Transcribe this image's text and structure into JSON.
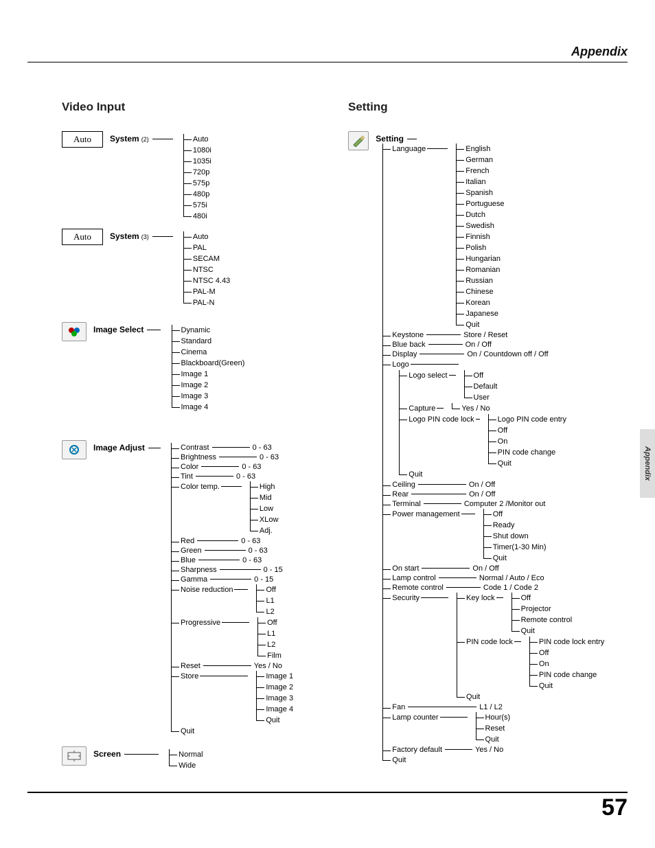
{
  "header": {
    "title": "Appendix"
  },
  "sideTab": "Appendix",
  "pageNumber": "57",
  "videoInput": {
    "title": "Video Input",
    "auto1": "Auto",
    "auto2": "Auto",
    "system2": {
      "label": "System",
      "note": "(2)",
      "items": [
        "Auto",
        "1080i",
        "1035i",
        "720p",
        "575p",
        "480p",
        "575i",
        "480i"
      ]
    },
    "system3": {
      "label": "System",
      "note": "(3)",
      "items": [
        "Auto",
        "PAL",
        "SECAM",
        "NTSC",
        "NTSC 4.43",
        "PAL-M",
        "PAL-N"
      ]
    },
    "imageSelect": {
      "label": "Image Select",
      "items": [
        "Dynamic",
        "Standard",
        "Cinema",
        "Blackboard(Green)",
        "Image 1",
        "Image 2",
        "Image 3",
        "Image 4"
      ]
    },
    "imageAdjust": {
      "label": "Image Adjust",
      "ranged": [
        {
          "k": "Contrast",
          "v": "0 - 63"
        },
        {
          "k": "Brightness",
          "v": "0 - 63"
        },
        {
          "k": "Color",
          "v": "0 - 63"
        },
        {
          "k": "Tint",
          "v": "0 - 63"
        }
      ],
      "colorTemp": {
        "k": "Color temp.",
        "items": [
          "High",
          "Mid",
          "Low",
          "XLow",
          "Adj."
        ]
      },
      "rgb": [
        {
          "k": "Red",
          "v": "0 - 63"
        },
        {
          "k": "Green",
          "v": "0 - 63"
        },
        {
          "k": "Blue",
          "v": "0 - 63"
        },
        {
          "k": "Sharpness",
          "v": "0 - 15"
        },
        {
          "k": "Gamma",
          "v": "0 - 15"
        }
      ],
      "noise": {
        "k": "Noise reduction",
        "items": [
          "Off",
          "L1",
          "L2"
        ]
      },
      "progressive": {
        "k": "Progressive",
        "items": [
          "Off",
          "L1",
          "L2",
          "Film"
        ]
      },
      "reset": {
        "k": "Reset",
        "v": "Yes / No"
      },
      "store": {
        "k": "Store",
        "items": [
          "Image 1",
          "Image 2",
          "Image 3",
          "Image 4",
          "Quit"
        ]
      },
      "quit": "Quit"
    },
    "screen": {
      "label": "Screen",
      "items": [
        "Normal",
        "Wide"
      ]
    }
  },
  "setting": {
    "title": "Setting",
    "label": "Setting",
    "language": {
      "k": "Language",
      "items": [
        "English",
        "German",
        "French",
        "Italian",
        "Spanish",
        "Portuguese",
        "Dutch",
        "Swedish",
        "Finnish",
        "Polish",
        "Hungarian",
        "Romanian",
        "Russian",
        "Chinese",
        "Korean",
        "Japanese",
        "Quit"
      ]
    },
    "keystone": {
      "k": "Keystone",
      "v": "Store / Reset"
    },
    "blueback": {
      "k": "Blue back",
      "v": "On / Off"
    },
    "display": {
      "k": "Display",
      "v": "On / Countdown off / Off"
    },
    "logo": {
      "k": "Logo",
      "logoSelect": {
        "k": "Logo select",
        "items": [
          "Off",
          "Default",
          "User"
        ]
      },
      "capture": {
        "k": "Capture",
        "items": [
          "Yes / No"
        ]
      },
      "pinLock": {
        "k": "Logo PIN code lock",
        "items": [
          "Logo PIN code entry",
          "Off",
          "On",
          "PIN code change",
          "Quit"
        ]
      },
      "quit": "Quit"
    },
    "ceiling": {
      "k": "Ceiling",
      "v": "On / Off"
    },
    "rear": {
      "k": "Rear",
      "v": "On / Off"
    },
    "terminal": {
      "k": "Terminal",
      "v": "Computer 2 /Monitor out"
    },
    "power": {
      "k": "Power management",
      "items": [
        "Off",
        "Ready",
        "Shut down",
        "Timer(1-30 Min)",
        "Quit"
      ]
    },
    "onstart": {
      "k": "On start",
      "v": "On / Off"
    },
    "lamp": {
      "k": "Lamp control",
      "v": "Normal / Auto / Eco"
    },
    "remote": {
      "k": "Remote control",
      "v": "Code 1 / Code 2"
    },
    "security": {
      "k": "Security",
      "keylock": {
        "k": "Key lock",
        "items": [
          "Off",
          "Projector",
          "Remote control",
          "Quit"
        ]
      },
      "pinlock": {
        "k": "PIN code lock",
        "items": [
          "PIN code lock entry",
          "Off",
          "On",
          "PIN code change",
          "Quit"
        ]
      },
      "quit": "Quit"
    },
    "fan": {
      "k": "Fan",
      "v": "L1 / L2"
    },
    "lampCounter": {
      "k": "Lamp counter",
      "items": [
        "Hour(s)",
        "Reset",
        "Quit"
      ]
    },
    "factory": {
      "k": "Factory default",
      "v": "Yes / No"
    },
    "quit": "Quit"
  }
}
